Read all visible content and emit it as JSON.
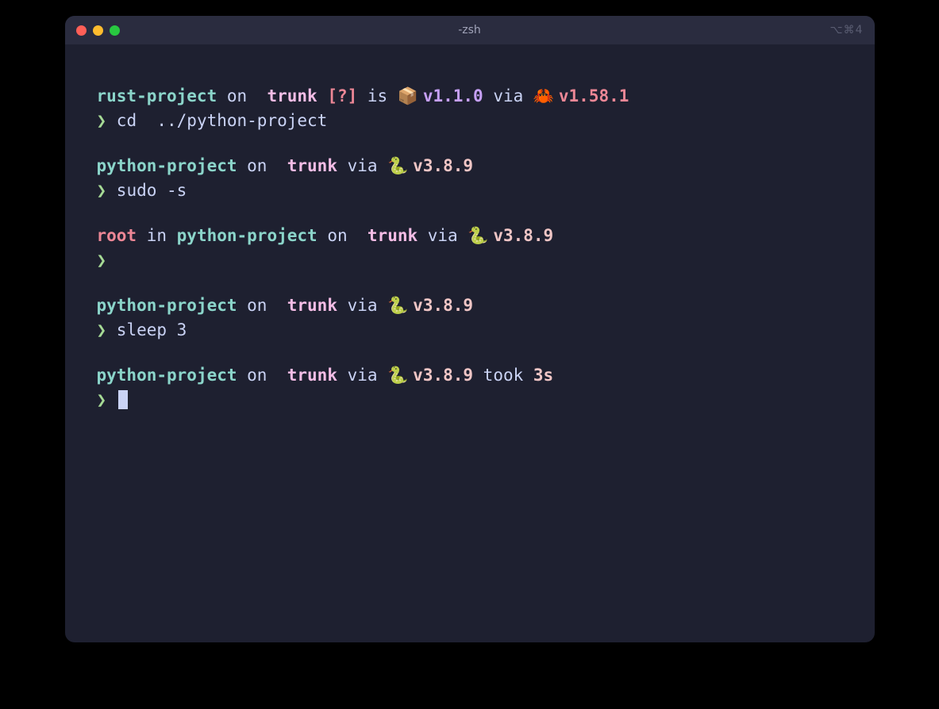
{
  "titlebar": {
    "title": "-zsh",
    "shortcut": "⌥⌘4"
  },
  "blocks": [
    {
      "prompt": [
        {
          "text": "rust-project",
          "class": "cyan-bold"
        },
        {
          "text": " on ",
          "class": "white"
        },
        {
          "text": "",
          "class": "pink-bold"
        },
        {
          "text": " ",
          "class": "white"
        },
        {
          "text": "trunk",
          "class": "pink-bold"
        },
        {
          "text": " ",
          "class": "white"
        },
        {
          "text": "[?]",
          "class": "red-bold"
        },
        {
          "text": " is ",
          "class": "white"
        },
        {
          "text": "📦 ",
          "class": "emoji"
        },
        {
          "text": "v1.1.0",
          "class": "purple-bold"
        },
        {
          "text": " via ",
          "class": "white"
        },
        {
          "text": "🦀 ",
          "class": "emoji"
        },
        {
          "text": "v1.58.1",
          "class": "red-bold"
        }
      ],
      "command": "cd  ../python-project"
    },
    {
      "prompt": [
        {
          "text": "python-project",
          "class": "cyan-bold"
        },
        {
          "text": " on ",
          "class": "white"
        },
        {
          "text": "",
          "class": "pink-bold"
        },
        {
          "text": " ",
          "class": "white"
        },
        {
          "text": "trunk",
          "class": "pink-bold"
        },
        {
          "text": " via ",
          "class": "white"
        },
        {
          "text": "🐍 ",
          "class": "emoji"
        },
        {
          "text": "v3.8.9",
          "class": "yellow-bold"
        }
      ],
      "command": "sudo -s"
    },
    {
      "prompt": [
        {
          "text": "root",
          "class": "red-bold"
        },
        {
          "text": " in ",
          "class": "white"
        },
        {
          "text": "python-project",
          "class": "cyan-bold"
        },
        {
          "text": " on ",
          "class": "white"
        },
        {
          "text": "",
          "class": "pink-bold"
        },
        {
          "text": " ",
          "class": "white"
        },
        {
          "text": "trunk",
          "class": "pink-bold"
        },
        {
          "text": " via ",
          "class": "white"
        },
        {
          "text": "🐍 ",
          "class": "emoji"
        },
        {
          "text": "v3.8.9",
          "class": "yellow-bold"
        }
      ],
      "command": ""
    },
    {
      "prompt": [
        {
          "text": "python-project",
          "class": "cyan-bold"
        },
        {
          "text": " on ",
          "class": "white"
        },
        {
          "text": "",
          "class": "pink-bold"
        },
        {
          "text": " ",
          "class": "white"
        },
        {
          "text": "trunk",
          "class": "pink-bold"
        },
        {
          "text": " via ",
          "class": "white"
        },
        {
          "text": "🐍 ",
          "class": "emoji"
        },
        {
          "text": "v3.8.9",
          "class": "yellow-bold"
        }
      ],
      "command": "sleep 3"
    },
    {
      "prompt": [
        {
          "text": "python-project",
          "class": "cyan-bold"
        },
        {
          "text": " on ",
          "class": "white"
        },
        {
          "text": "",
          "class": "pink-bold"
        },
        {
          "text": " ",
          "class": "white"
        },
        {
          "text": "trunk",
          "class": "pink-bold"
        },
        {
          "text": " via ",
          "class": "white"
        },
        {
          "text": "🐍 ",
          "class": "emoji"
        },
        {
          "text": "v3.8.9",
          "class": "yellow-bold"
        },
        {
          "text": " took ",
          "class": "white"
        },
        {
          "text": "3s",
          "class": "yellow-bold"
        }
      ],
      "command": "",
      "cursor": true
    }
  ],
  "prompt_arrow": "❯"
}
